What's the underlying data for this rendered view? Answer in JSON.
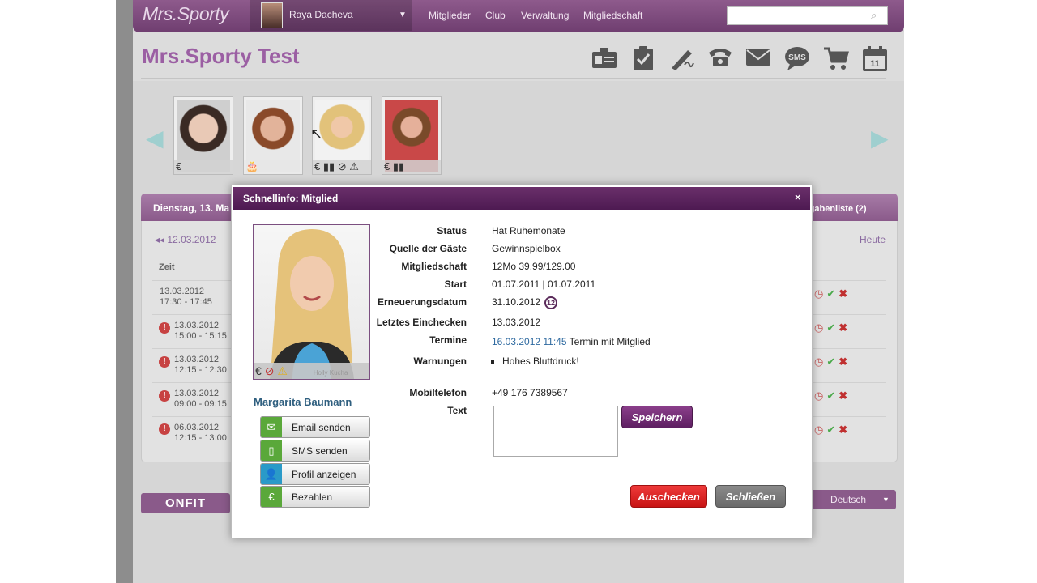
{
  "app": {
    "logo": "Mrs.Sporty",
    "user_name": "Raya Dacheva",
    "nav": [
      "Mitglieder",
      "Club",
      "Verwaltung",
      "Mitgliedschaft"
    ],
    "page_title": "Mrs.Sporty Test"
  },
  "toolbar_icons": [
    "member-card-icon",
    "checklist-icon",
    "signature-pen-icon",
    "phone-icon",
    "email-icon",
    "sms-icon",
    "cart-icon",
    "calendar-icon"
  ],
  "sms_label": "SMS",
  "calendar_day": "11",
  "carousel": {
    "thumb_glyphs": [
      "€",
      "€ ▮▮ ⊘ ⚠",
      "€ ▮▮"
    ]
  },
  "panel": {
    "date_header": "Dienstag, 13. Ma",
    "tasks_label": "fgabenliste (2)",
    "prev_date": "12.03.2012",
    "heute": "Heute",
    "col_zeit": "Zeit",
    "rows": [
      {
        "date": "13.03.2012",
        "time": "17:30 - 17:45",
        "warn": false
      },
      {
        "date": "13.03.2012",
        "time": "15:00 - 15:15",
        "warn": true
      },
      {
        "date": "13.03.2012",
        "time": "12:15 - 12:30",
        "warn": true
      },
      {
        "date": "13.03.2012",
        "time": "09:00 - 09:15",
        "warn": true
      },
      {
        "date": "06.03.2012",
        "time": "12:15 - 13:00",
        "warn": true
      }
    ]
  },
  "footer": {
    "onfit": "ONFIT",
    "language": "Deutsch"
  },
  "modal": {
    "title": "Schnellinfo: Mitglied",
    "close": "×",
    "photo_watermark": "Holly Kucha",
    "member_name": "Margarita Baumann",
    "actions": [
      {
        "label": "Email senden",
        "color": "#5aa83a"
      },
      {
        "label": "SMS senden",
        "color": "#5aa83a"
      },
      {
        "label": "Profil anzeigen",
        "color": "#2a9ac8"
      },
      {
        "label": "Bezahlen",
        "color": "#5aa83a"
      }
    ],
    "fields": {
      "status_label": "Status",
      "status": "Hat Ruhemonate",
      "quelle_label": "Quelle der Gäste",
      "quelle": "Gewinnspielbox",
      "mitgliedschaft_label": "Mitgliedschaft",
      "mitgliedschaft": "12Mo 39.99/129.00",
      "start_label": "Start",
      "start": "01.07.2011 | 01.07.2011",
      "erneuerung_label": "Erneuerungsdatum",
      "erneuerung": "31.10.2012",
      "erneuerung_badge": "12",
      "einchecken_label": "Letztes Einchecken",
      "einchecken": "13.03.2012",
      "termine_label": "Termine",
      "termine_link": "16.03.2012 11:45",
      "termine_text": "Termin mit Mitglied",
      "warnungen_label": "Warnungen",
      "warnung_1": "Hohes Bluttdruck!",
      "mobil_label": "Mobiltelefon",
      "mobil": "+49 176 7389567",
      "text_label": "Text"
    },
    "buttons": {
      "save": "Speichern",
      "checkout": "Auschecken",
      "close": "Schließen"
    }
  }
}
